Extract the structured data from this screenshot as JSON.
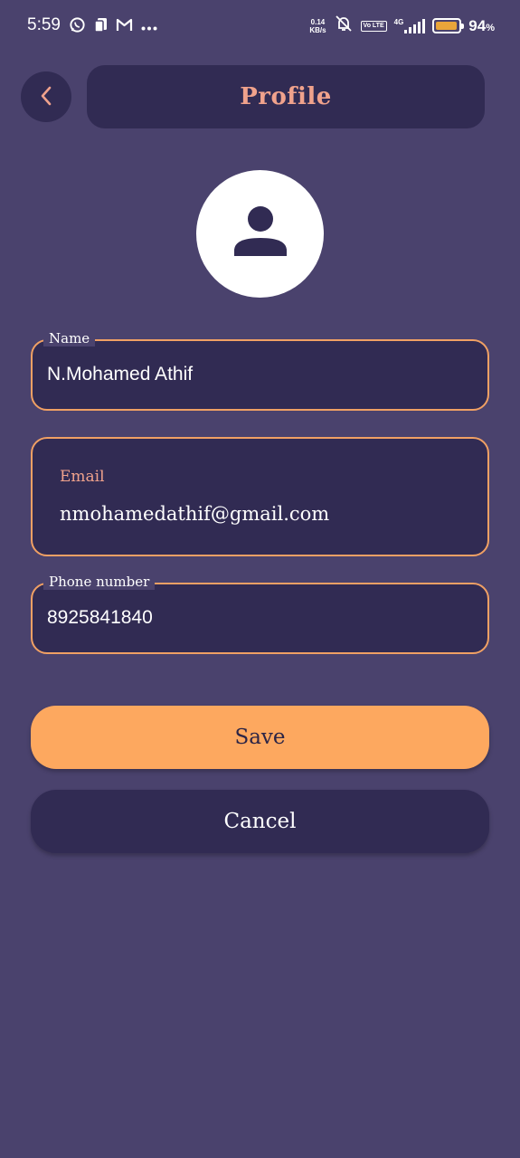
{
  "status_bar": {
    "time": "5:59",
    "left_icons": [
      "whatsapp-icon",
      "sim-card-icon",
      "gmail-icon",
      "more-dots-icon"
    ],
    "net_speed_value": "0.14",
    "net_speed_unit": "KB/s",
    "volte_badge": "Vo LTE",
    "network": "4G",
    "battery_percent_value": "94",
    "battery_percent_unit": "%",
    "battery_level": 0.94
  },
  "header": {
    "title": "Profile",
    "back_icon": "chevron-left-icon"
  },
  "avatar": {
    "icon": "person-icon"
  },
  "form": {
    "name": {
      "label": "Name",
      "value": "N.Mohamed Athif"
    },
    "email": {
      "label": "Email",
      "value": "nmohamedathif@gmail.com"
    },
    "phone": {
      "label": "Phone number",
      "value": "8925841840"
    }
  },
  "actions": {
    "save_label": "Save",
    "cancel_label": "Cancel"
  },
  "colors": {
    "background": "#4a426d",
    "surface": "#312b53",
    "accent": "#fda85f",
    "title": "#f0a28c",
    "field_border": "#f0a064"
  }
}
